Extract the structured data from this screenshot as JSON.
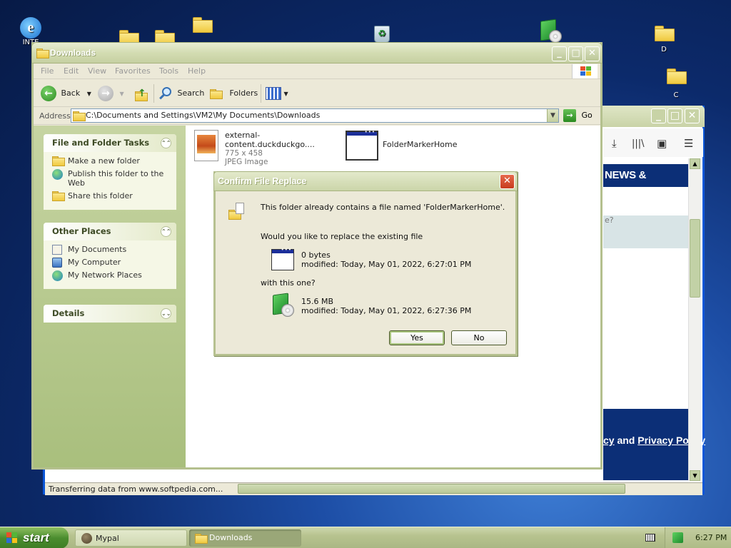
{
  "desktop": {
    "icons": [
      {
        "label": "INTE"
      },
      {
        "label": "D"
      },
      {
        "label": "C"
      }
    ]
  },
  "browser": {
    "nav_text": "NEWS & REVIEWS",
    "gray_text": "e?",
    "footer_prefix": "cy",
    "footer_and": " and ",
    "footer_link": "Privacy Policy",
    "status_text": "Transferring data from www.softpedia.com..."
  },
  "explorer": {
    "title": "Downloads",
    "menu": [
      "File",
      "Edit",
      "View",
      "Favorites",
      "Tools",
      "Help"
    ],
    "toolbar": {
      "back_label": "Back",
      "search_label": "Search",
      "folders_label": "Folders"
    },
    "address_label": "Address",
    "address_value": "C:\\Documents and Settings\\VM2\\My Documents\\Downloads",
    "go_label": "Go",
    "task_pane": {
      "file_tasks": {
        "title": "File and Folder Tasks",
        "items": [
          "Make a new folder",
          "Publish this folder to the Web",
          "Share this folder"
        ]
      },
      "other_places": {
        "title": "Other Places",
        "items": [
          "My Documents",
          "My Computer",
          "My Network Places"
        ]
      },
      "details": {
        "title": "Details"
      }
    },
    "files": [
      {
        "name": "external-content.duckduckgo....",
        "dims": "775 x 458",
        "type": "JPEG Image"
      },
      {
        "name": "FolderMarkerHome"
      }
    ]
  },
  "dialog": {
    "title": "Confirm File Replace",
    "message": "This folder already contains a file named 'FolderMarkerHome'.",
    "question": "Would you like to replace the existing file",
    "existing_size": "0 bytes",
    "existing_modified": "modified: Today, May 01, 2022, 6:27:01 PM",
    "with_text": "with this one?",
    "new_size": "15.6 MB",
    "new_modified": "modified: Today, May 01, 2022, 6:27:36 PM",
    "yes_label": "Yes",
    "no_label": "No"
  },
  "taskbar": {
    "start_label": "start",
    "tasks": [
      {
        "label": "Mypal"
      },
      {
        "label": "Downloads"
      }
    ],
    "clock": "6:27 PM"
  }
}
